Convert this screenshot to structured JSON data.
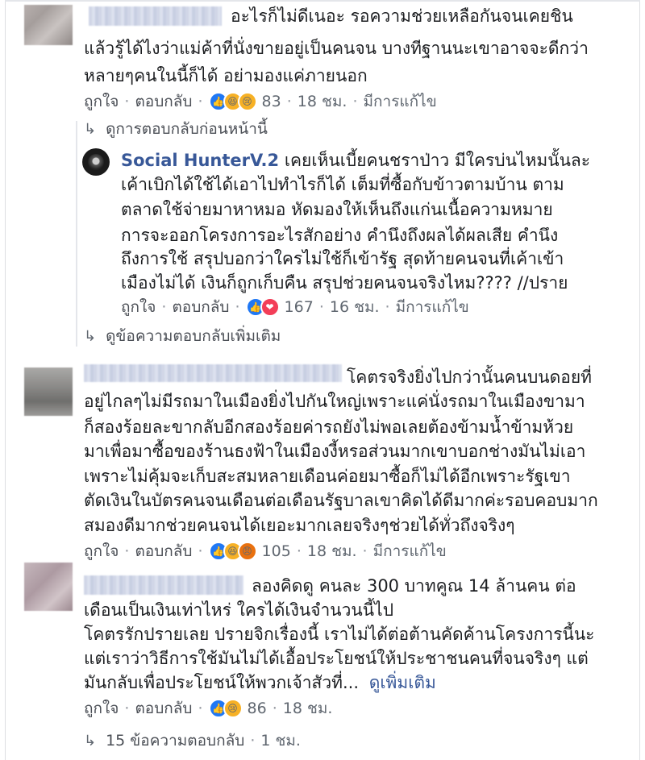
{
  "comments": [
    {
      "lines": [
        "อะไรก็ไม่ดีเนอะ รอความช่วยเหลือกันจนเคยชิน",
        "แล้วรู้ได้ไงว่าแม่ค้าที่นั่งขายอยู่เป็นคนจน บางทีฐานนะเขาอาจจะดีกว่า",
        "หลายๆคนในนี้ก็ได้ อย่ามองแค่ภายนอก"
      ],
      "actions": {
        "like": "ถูกใจ",
        "reply": "ตอบกลับ",
        "reactions": [
          "like",
          "haha",
          "sad"
        ],
        "count": "83",
        "time": "18 ชม.",
        "edited": "มีการแก้ไข"
      },
      "prev_replies": "ดูการตอบกลับก่อนหน้านี้",
      "reply": {
        "name": "Social HunterV.2",
        "lines": [
          "เคยเห็นเบี้ยคนชราป่าว มีใครบ่นไหมนั้นละ",
          "เค้าเบิกได้ใช้ได้เอาไปทำไรก็ได้ เต็มที่ซื้อกับข้าวตามบ้าน ตาม",
          "ตลาดใช้จ่ายมาหาหมอ หัดมองให้เห็นถึงแก่นเนื้อความหมาย",
          "การจะออกโครงการอะไรสักอย่าง คำนึงถึงผลได้ผลเสีย คำนึง",
          "ถึงการใช้ สรุปบอกว่าใครไม่ใช้ก็เข้ารัฐ สุดท้ายคนจนที่เค้าเข้า",
          "เมืองไม่ได้ เงินก็ถูกเก็บคืน สรุปช่วยคนจนจริงไหม???? //ปราย"
        ],
        "actions": {
          "like": "ถูกใจ",
          "reply": "ตอบกลับ",
          "reactions": [
            "like",
            "love"
          ],
          "count": "167",
          "time": "16 ชม.",
          "edited": "มีการแก้ไข"
        }
      },
      "more_replies": "ดูข้อความตอบกลับเพิ่มเติม"
    },
    {
      "lines": [
        "โคตรจริงยิ่งไปกว่านั้นคนบนดอยที่",
        "อยู่ไกลๆไม่มีรถมาในเมืองยิ่งไปกันใหญ่เพราะแค่นั่งรถมาในเมืองขามา",
        "ก็สองร้อยละขากลับอีกสองร้อยค่ารถยังไม่พอเลยต้องข้ามน้ำข้ามห้วย",
        "มาเพื่อมาซื้อของร้านธงฟ้าในเมืองงี้หรอส่วนมากเขาบอกช่างมันไม่เอา",
        "เพราะไม่คุ้มจะเก็บสะสมหลายเดือนค่อยมาซื้อก็ไม่ได้อีกเพราะรัฐเขา",
        "ตัดเงินในบัตรคนจนเดือนต่อเดือนรัฐบาลเขาคิดได้ดีมากค่ะรอบคอบมาก",
        "สมองดีมากช่วยคนจนได้เยอะมากเลยจริงๆช่วยได้ทั่วถึงจริงๆ"
      ],
      "actions": {
        "like": "ถูกใจ",
        "reply": "ตอบกลับ",
        "reactions": [
          "like",
          "haha",
          "angry"
        ],
        "count": "105",
        "time": "18 ชม.",
        "edited": "มีการแก้ไข"
      }
    },
    {
      "lines": [
        "ลองคิดดู คนละ 300 บาทคูณ 14 ล้านคน ต่อ",
        "เดือนเป็นเงินเท่าไหร่ ใครได้เงินจำนวนนี้ไป",
        "โคตรรักปรายเลย ปรายจิกเรื่องนี้ เราไม่ได้ต่อต้านคัดค้านโครงการนี้นะ",
        "แต่เราว่าวิธีการใช้มันไม่ได้เอื้อประโยชน์ให้ประชาชนคนที่จนจริงๆ แต่",
        "มันกลับเพื่อประโยชน์ให้พวกเจ้าสัวที่..."
      ],
      "see_more": "ดูเพิ่มเติม",
      "actions": {
        "like": "ถูกใจ",
        "reply": "ตอบกลับ",
        "reactions": [
          "like",
          "sad"
        ],
        "count": "86",
        "time": "18 ชม."
      },
      "replies_count": "15 ข้อความตอบกลับ",
      "replies_time": "1 ชม."
    }
  ],
  "colors": {
    "link": "#385898",
    "meta": "#606770",
    "like": "#2078f4",
    "love": "#f33e58",
    "haha": "#f7b125"
  }
}
